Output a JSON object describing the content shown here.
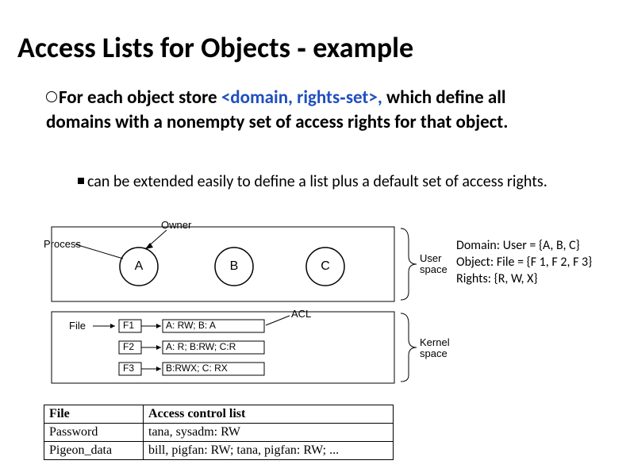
{
  "title": "Access Lists for Objects ‐  example",
  "bullet1_pre": "For each object store ",
  "bullet1_blue": "<domain, rights‐set>,",
  "bullet1_post": " which define all domains with a nonempty set of access rights for that object.",
  "bullet2": "can be extended easily to define a list plus a default set of access rights.",
  "diagram": {
    "process": "Process",
    "owner": "Owner",
    "a": "A",
    "b": "B",
    "c": "C",
    "user_space": "User",
    "user_space2": "space",
    "file": "File",
    "f1": "F1",
    "f2": "F2",
    "f3": "F3",
    "acl": "ACL",
    "row1": "A: RW;   B: A",
    "row2": "A: R;   B:RW;   C:R",
    "row3": "B:RWX;   C: RX",
    "kernel": "Kernel",
    "kernel2": "space"
  },
  "side": {
    "l1": "Domain: User = {A, B, C}",
    "l2": "Object: File  = {F 1, F 2, F 3}",
    "l3": "Rights: {R, W, X}"
  },
  "table": {
    "h1": "File",
    "h2": "Access control list",
    "r1c1": "Password",
    "r1c2": "tana, sysadm: RW",
    "r2c1": "Pigeon_data",
    "r2c2": "bill, pigfan: RW;  tana, pigfan: RW; ..."
  }
}
